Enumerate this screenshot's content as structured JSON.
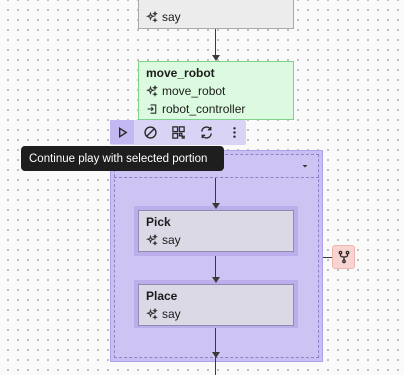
{
  "nodes": {
    "say_top": {
      "title": "say",
      "rows": [
        {
          "icon": "sparkles-icon",
          "label": "say"
        }
      ]
    },
    "move_robot": {
      "title": "move_robot",
      "rows": [
        {
          "icon": "sparkles-icon",
          "label": "move_robot"
        },
        {
          "icon": "login-icon",
          "label": "robot_controller"
        }
      ]
    }
  },
  "toolbar": {
    "buttons": [
      {
        "name": "play-button",
        "icon": "play-icon",
        "active": true
      },
      {
        "name": "disable-button",
        "icon": "ban-icon"
      },
      {
        "name": "layout-button",
        "icon": "grid-icon"
      },
      {
        "name": "loop-button",
        "icon": "refresh-icon"
      },
      {
        "name": "more-button",
        "icon": "dots-vertical-icon"
      }
    ],
    "tooltip": "Continue play with selected portion"
  },
  "group": {
    "collapse_icon": "caret-down-icon",
    "children": [
      {
        "title": "Pick",
        "row_label": "say",
        "row_icon": "sparkles-icon"
      },
      {
        "title": "Place",
        "row_label": "say",
        "row_icon": "sparkles-icon"
      }
    ]
  },
  "side_button": {
    "icon": "git-fork-icon"
  },
  "colors": {
    "canvas": "#fafafa",
    "selected_node": "#dcfadf",
    "selected_border": "#7fd18b",
    "group_fill": "#c9bef1",
    "tooltip_bg": "#1e1e1e",
    "branch_button": "#f7d3d1"
  }
}
